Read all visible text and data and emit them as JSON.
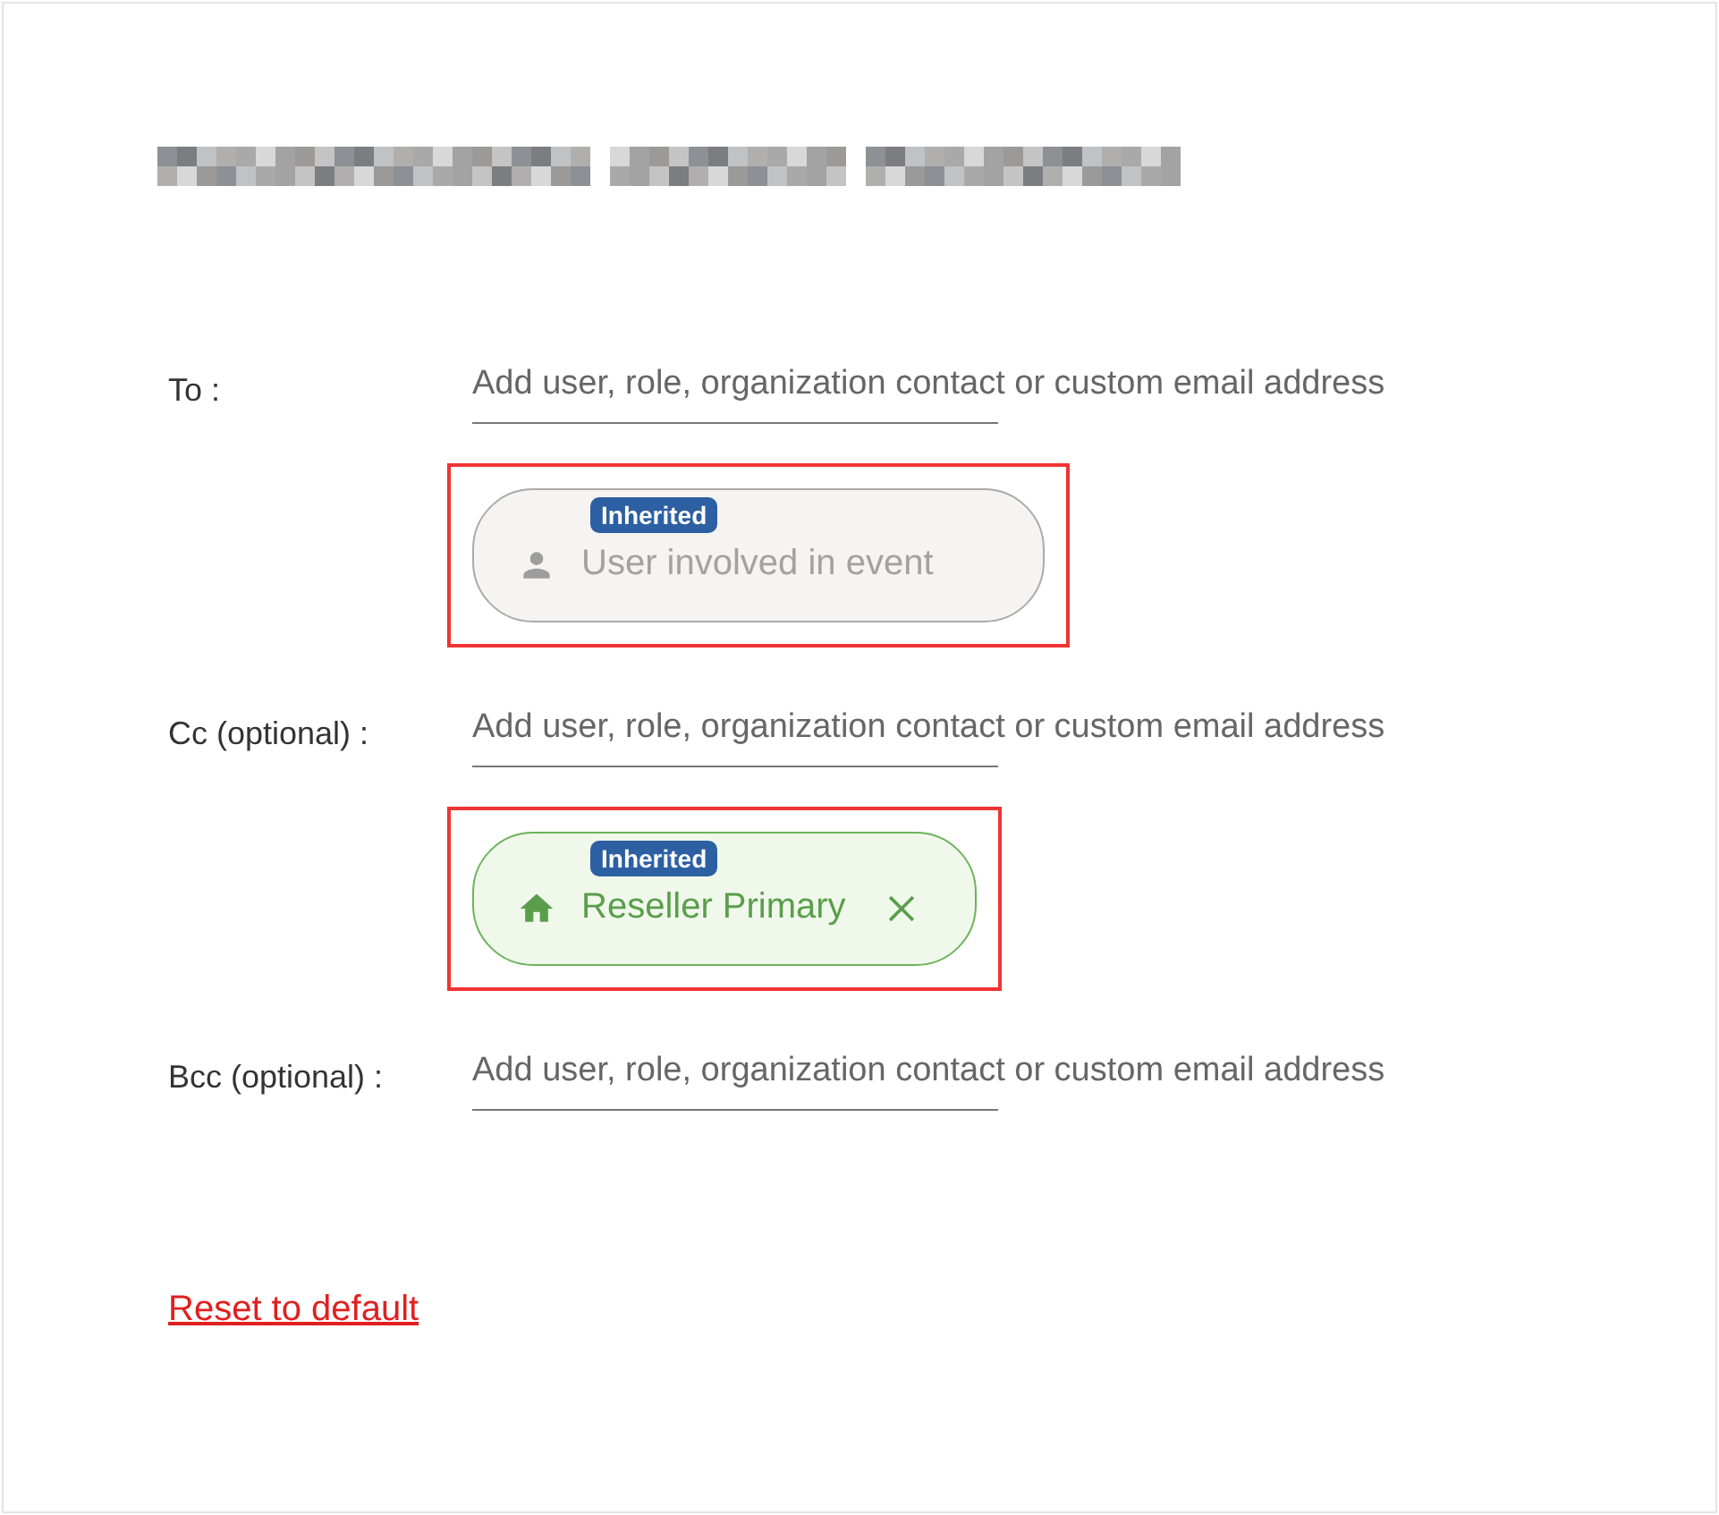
{
  "recipients": [
    {
      "label": "To :",
      "placeholder": "Add user, role, organization contact or custom email address",
      "chips": [
        {
          "kind": "user",
          "badge": "Inherited",
          "text": "User involved in event",
          "removable": false,
          "highlighted": true
        }
      ]
    },
    {
      "label": "Cc (optional) :",
      "placeholder": "Add user, role, organization contact or custom email address",
      "chips": [
        {
          "kind": "organization",
          "badge": "Inherited",
          "text": "Reseller Primary",
          "removable": true,
          "highlighted": true
        }
      ]
    },
    {
      "label": "Bcc (optional) :",
      "placeholder": "Add user, role, organization contact or custom email address"
    }
  ],
  "reset_link": "Reset to default"
}
